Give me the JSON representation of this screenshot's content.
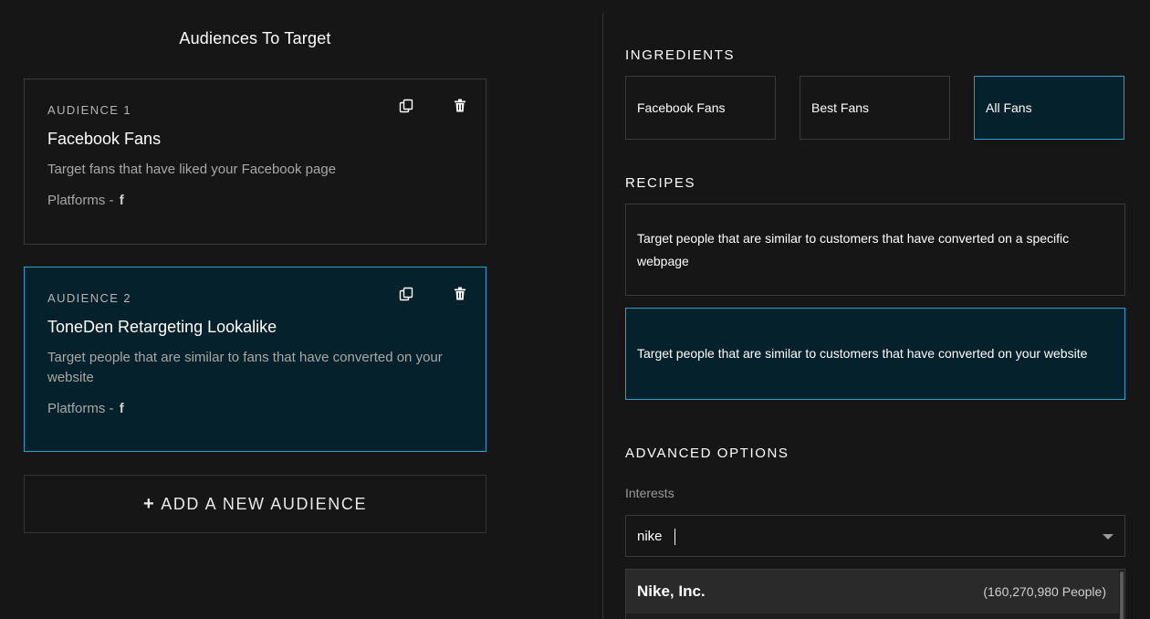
{
  "left": {
    "title": "Audiences To Target",
    "audiences": [
      {
        "label": "AUDIENCE 1",
        "title": "Facebook Fans",
        "description": "Target fans that have liked your Facebook page",
        "platforms_label": "Platforms -",
        "platform_icon": "facebook-icon",
        "selected": false
      },
      {
        "label": "AUDIENCE 2",
        "title": "ToneDen Retargeting Lookalike",
        "description": "Target people that are similar to fans that have converted on your website",
        "platforms_label": "Platforms -",
        "platform_icon": "facebook-icon",
        "selected": true
      }
    ],
    "add_button_label": "ADD A NEW AUDIENCE"
  },
  "right": {
    "ingredients_heading": "INGREDIENTS",
    "ingredients": [
      {
        "label": "Facebook Fans",
        "selected": false
      },
      {
        "label": "Best Fans",
        "selected": false
      },
      {
        "label": "All Fans",
        "selected": true
      }
    ],
    "recipes_heading": "RECIPES",
    "recipes": [
      {
        "label": "Target people that are similar to customers that have converted on a specific webpage",
        "selected": false
      },
      {
        "label": "Target people that are similar to customers that have converted on your website",
        "selected": true
      }
    ],
    "advanced_heading": "ADVANCED OPTIONS",
    "interests_label": "Interests",
    "interests_value": "nike",
    "dropdown_options": [
      {
        "name": "Nike, Inc.",
        "count": "(160,270,980 People)"
      }
    ]
  },
  "colors": {
    "background": "#161616",
    "accent_border": "#2a9fcf",
    "selected_bg": "#05212b"
  }
}
